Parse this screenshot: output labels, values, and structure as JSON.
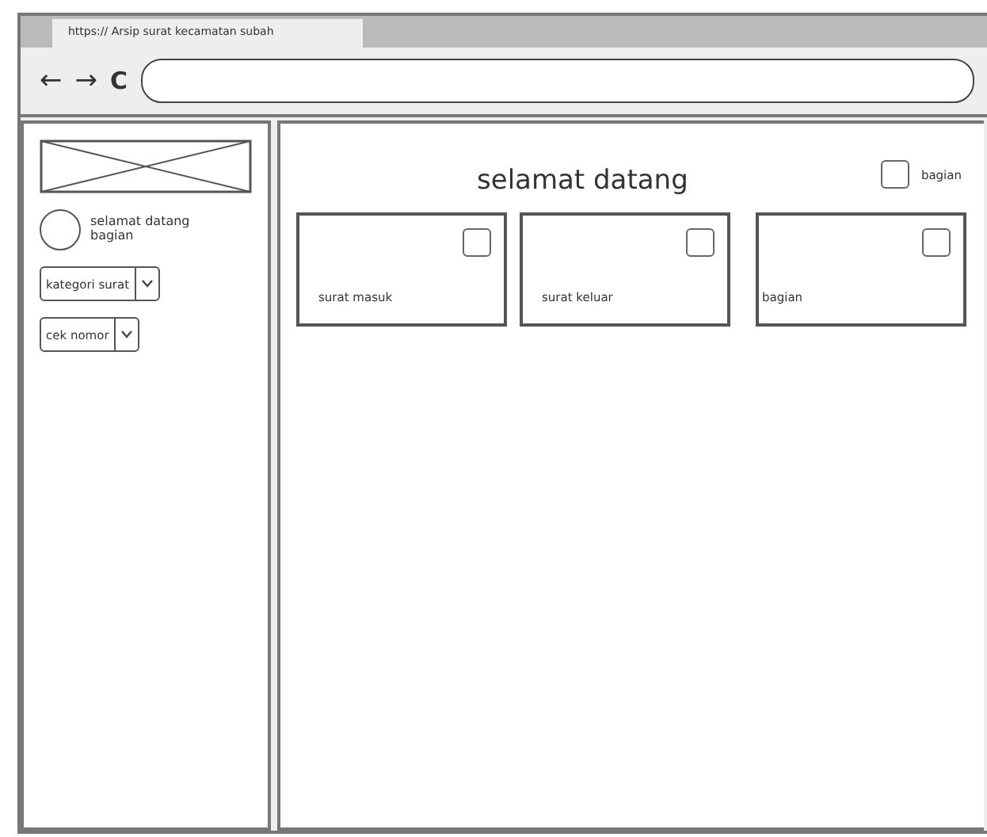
{
  "browser": {
    "tab_title": "https:// Arsip surat kecamatan subah",
    "back": "←",
    "forward": "→",
    "reload": "C"
  },
  "sidebar": {
    "greeting": "selamat datang bagian",
    "dropdowns": [
      {
        "label": "kategori surat"
      },
      {
        "label": "cek nomor"
      }
    ]
  },
  "main": {
    "title": "selamat datang",
    "header_checkbox": {
      "label": "bagian",
      "checked": false
    },
    "cards": [
      {
        "label": "surat masuk",
        "checked": false
      },
      {
        "label": "surat keluar",
        "checked": false
      },
      {
        "label": "bagian",
        "checked": false
      }
    ]
  }
}
